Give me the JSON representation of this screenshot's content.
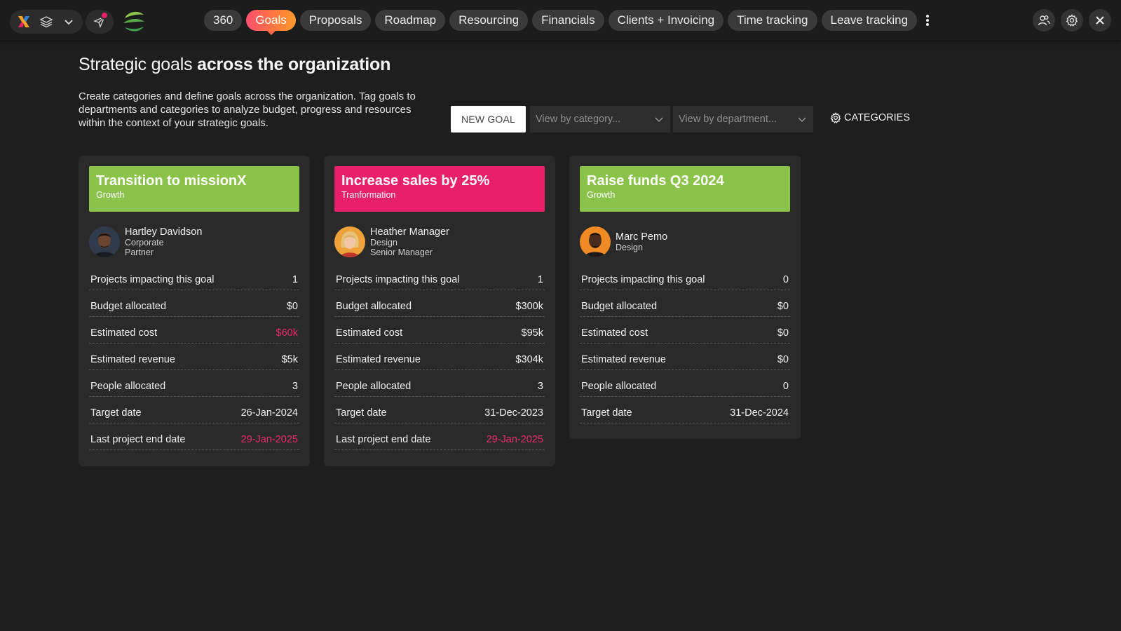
{
  "colors": {
    "growth": "#8bc34a",
    "transformation": "#e8206a",
    "accent_red": "#ea2a6a",
    "background": "#1e1e1e",
    "card": "#2a2a2a"
  },
  "toolbar": {
    "icons": [
      "app-logo-icon",
      "layers-icon",
      "chevron-down-icon",
      "send-icon",
      "brand-logo-icon"
    ],
    "right_icons": [
      "users-icon",
      "gear-icon",
      "close-icon"
    ]
  },
  "tabs": [
    {
      "label": "360",
      "active": false
    },
    {
      "label": "Goals",
      "active": true
    },
    {
      "label": "Proposals",
      "active": false
    },
    {
      "label": "Roadmap",
      "active": false
    },
    {
      "label": "Resourcing",
      "active": false
    },
    {
      "label": "Financials",
      "active": false
    },
    {
      "label": "Clients + Invoicing",
      "active": false
    },
    {
      "label": "Time tracking",
      "active": false
    },
    {
      "label": "Leave tracking",
      "active": false
    }
  ],
  "page": {
    "title_regular": "Strategic goals ",
    "title_bold": "across the organization",
    "description": "Create categories and define goals across the organization. Tag goals to departments and categories to analyze budget, progress and resources within the context of your strategic goals."
  },
  "controls": {
    "new_goal": "NEW GOAL",
    "category_placeholder": "View by category...",
    "department_placeholder": "View by department...",
    "categories": "CATEGORIES"
  },
  "labels": {
    "projects": "Projects impacting this goal",
    "budget": "Budget allocated",
    "cost": "Estimated cost",
    "revenue": "Estimated revenue",
    "people": "People allocated",
    "target": "Target date",
    "last_end": "Last project end date"
  },
  "goals": [
    {
      "title": "Transition to missionX",
      "category": "Growth",
      "color": "#8bc34a",
      "owner": {
        "name": "Hartley Davidson",
        "department": "Corporate",
        "role": "Partner"
      },
      "projects": "1",
      "budget": "$0",
      "cost": "$60k",
      "cost_red": true,
      "revenue": "$5k",
      "people": "3",
      "target": "26-Jan-2024",
      "last_end": "29-Jan-2025",
      "last_end_red": true
    },
    {
      "title": "Increase sales by 25%",
      "category": "Tranformation",
      "color": "#e8206a",
      "owner": {
        "name": "Heather Manager",
        "department": "Design",
        "role": "Senior Manager"
      },
      "projects": "1",
      "budget": "$300k",
      "cost": "$95k",
      "cost_red": false,
      "revenue": "$304k",
      "people": "3",
      "target": "31-Dec-2023",
      "last_end": "29-Jan-2025",
      "last_end_red": true
    },
    {
      "title": "Raise funds Q3 2024",
      "category": "Growth",
      "color": "#8bc34a",
      "owner": {
        "name": "Marc Pemo",
        "department": "Design",
        "role": ""
      },
      "projects": "0",
      "budget": "$0",
      "cost": "$0",
      "cost_red": false,
      "revenue": "$0",
      "people": "0",
      "target": "31-Dec-2024"
    }
  ]
}
